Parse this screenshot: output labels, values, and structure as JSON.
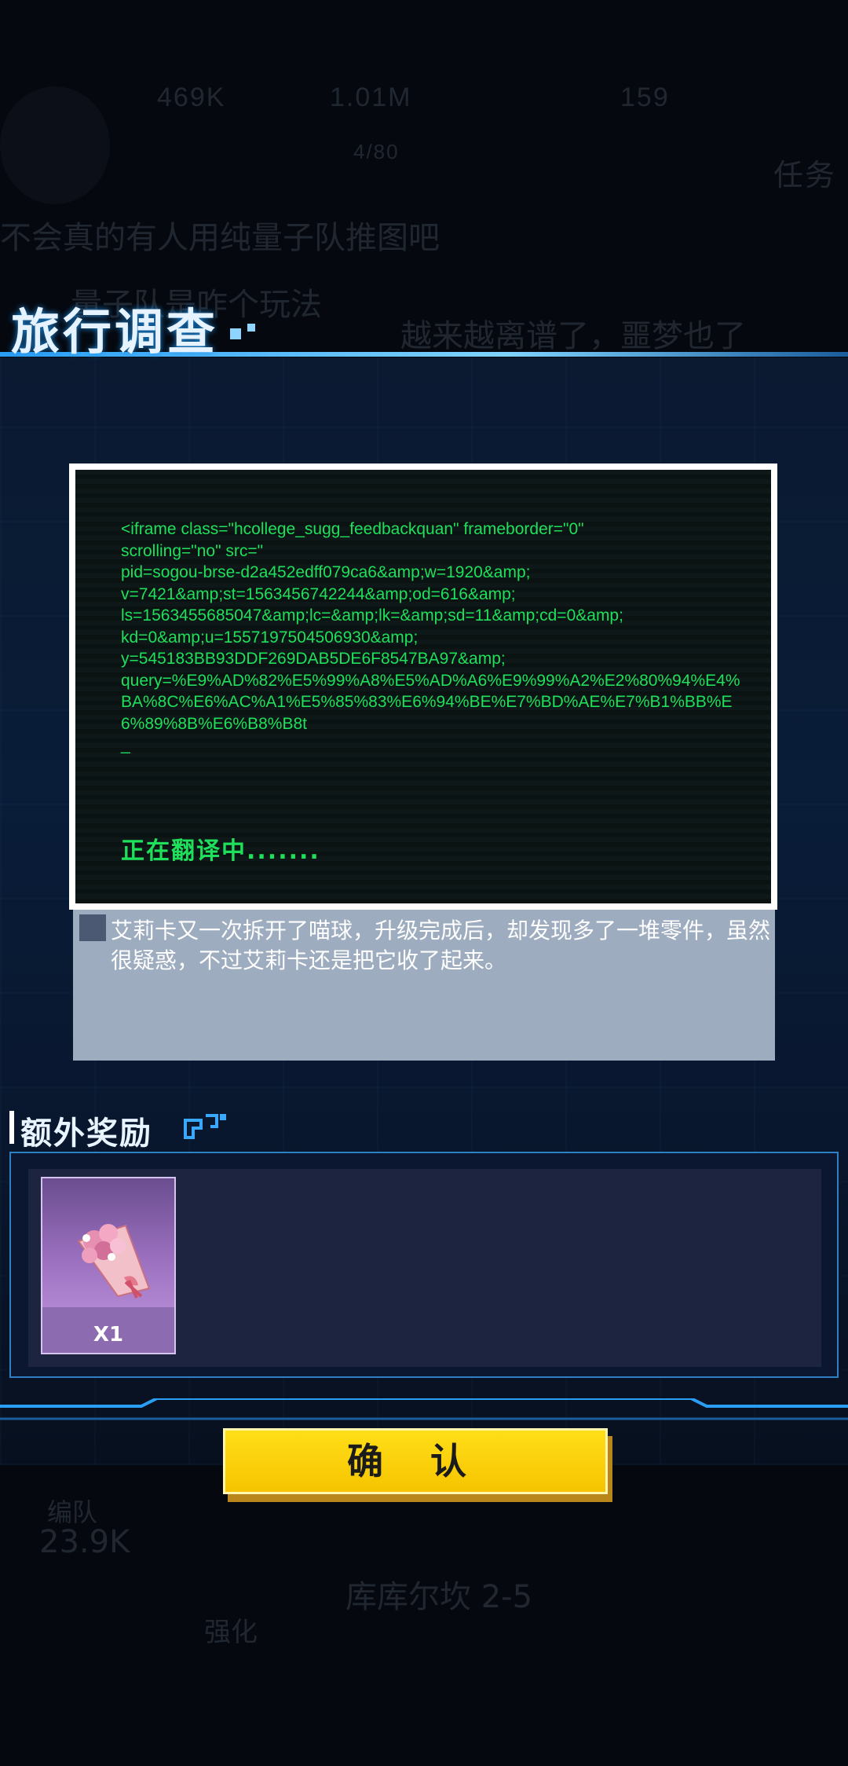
{
  "background": {
    "stat_1": "469K",
    "stat_2": "1.01M",
    "stat_3": "159",
    "sub_value": "4/80",
    "task_label": "任务",
    "line_1": "不会真的有人用纯量子队推图吧",
    "line_2": "量子队是咋个玩法",
    "line_3": "越来越离谱了，噩梦也了",
    "team_label": "编队",
    "team_power": "23.9K",
    "stage": "库库尔坎 2-5",
    "strengthen": "强化"
  },
  "modal": {
    "title": "旅行调查",
    "terminal": {
      "code": "<iframe class=\"hcollege_sugg_feedbackquan\" frameborder=\"0\"\nscrolling=\"no\" src=\"\npid=sogou-brse-d2a452edff079ca6&amp;w=1920&amp;\nv=7421&amp;st=1563456742244&amp;od=616&amp;\nls=1563455685047&amp;lc=&amp;lk=&amp;sd=11&amp;cd=0&amp;\nkd=0&amp;u=1557197504506930&amp;\ny=545183BB93DDF269DAB5DE6F8547BA97&amp;\nquery=%E9%AD%82%E5%99%A8%E5%AD%A6%E9%99%A2%E2%80%94%E4%BA%8C%E6%AC%A1%E5%85%83%E6%94%BE%E7%BD%AE%E7%B1%BB%E6%89%8B%E6%B8%B8t\n_",
      "status": "正在翻译中......."
    },
    "description": "艾莉卡又一次拆开了喵球，升级完成后，却发现多了一堆零件，虽然很疑惑，不过艾莉卡还是把它收了起来。",
    "extra_reward_label": "额外奖励",
    "reward_item": {
      "icon": "flower-bouquet-icon",
      "quantity": "X1"
    },
    "confirm_label": "确 认"
  },
  "colors": {
    "terminal_text": "#1fe05a",
    "confirm_button": "#f6c400",
    "accent": "#2a9df4"
  }
}
